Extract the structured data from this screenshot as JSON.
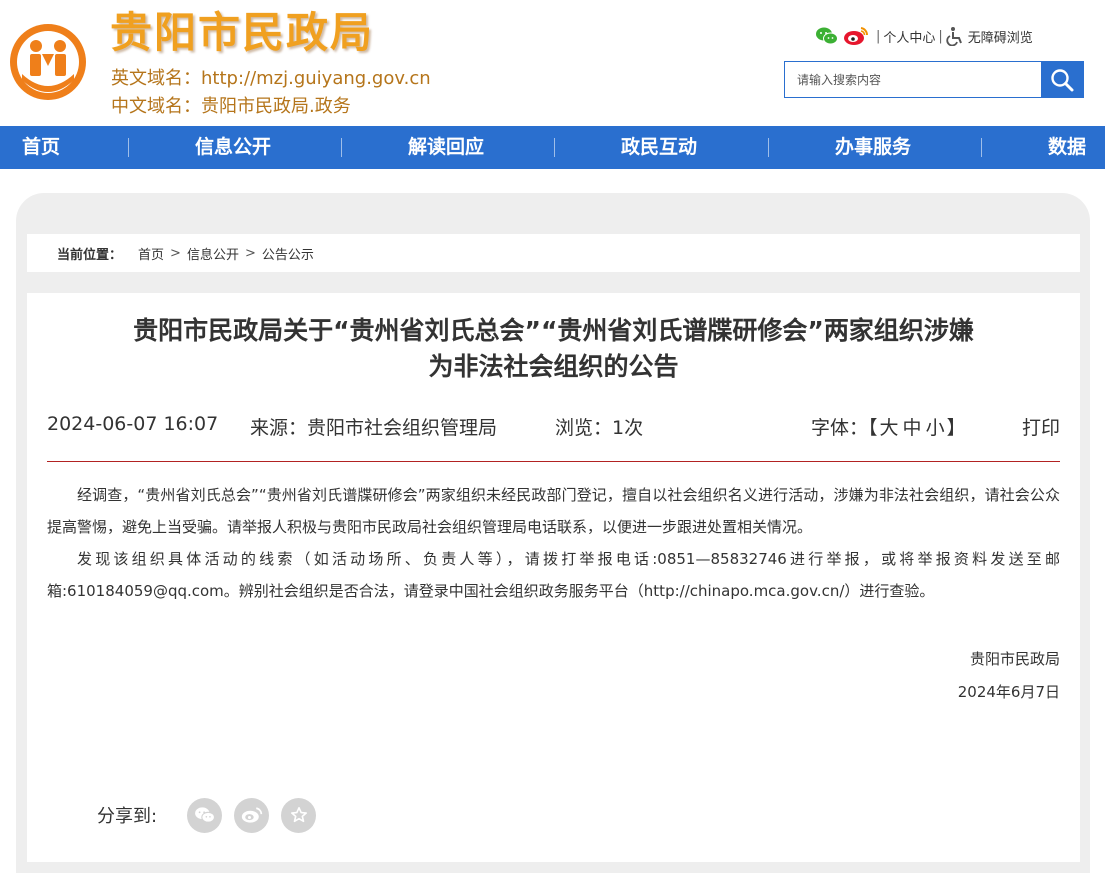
{
  "site": {
    "title": "贵阳市民政局",
    "domain_en": "英文域名：http://mzj.guiyang.gov.cn",
    "domain_cn": "中文域名：贵阳市民政局.政务",
    "logo_icon": "civil-affairs-emblem",
    "brand_color": "#f0a020"
  },
  "top_tools": {
    "wechat_icon": "wechat-icon",
    "weibo_icon": "weibo-icon",
    "personal_center": "个人中心",
    "accessibility_icon": "wheelchair-icon",
    "accessible_browse": "无障碍浏览"
  },
  "search": {
    "placeholder": "请输入搜索内容",
    "button_icon": "search-icon"
  },
  "nav": {
    "color": "#2a6fcf",
    "items": [
      {
        "label": "首页"
      },
      {
        "label": "信息公开"
      },
      {
        "label": "解读回应"
      },
      {
        "label": "政民互动"
      },
      {
        "label": "办事服务"
      },
      {
        "label": "数据"
      }
    ]
  },
  "breadcrumb": {
    "label": "当前位置：",
    "items": [
      {
        "label": "首页"
      },
      {
        "label": "信息公开"
      },
      {
        "label": "公告公示"
      }
    ]
  },
  "article": {
    "title_line1": "贵阳市民政局关于“贵州省刘氏总会”“贵州省刘氏谱牒研修会”两家组织涉嫌",
    "title_line2": "为非法社会组织的公告",
    "date": "2024-06-07 16:07",
    "source_label": "来源：",
    "source": "贵阳市社会组织管理局",
    "views_label": "浏览：",
    "views": "1次",
    "font_label": "字体：",
    "font_open": "【",
    "font_large": "大",
    "font_medium": "中",
    "font_small": "小",
    "font_close": "】",
    "print": "打印",
    "divider_color": "#b22222",
    "paragraphs": [
      "经调查，“贵州省刘氏总会”“贵州省刘氏谱牒研修会”两家组织未经民政部门登记，擅自以社会组织名义进行活动，涉嫌为非法社会组织，请社会公众提高警惕，避免上当受骗。请举报人积极与贵阳市民政局社会组织管理局电话联系，以便进一步跟进处置相关情况。",
      "发现该组织具体活动的线索（如活动场所、负责人等），请拨打举报电话:0851—85832746进行举报，或将举报资料发送至邮箱:610184059@qq.com。辨别社会组织是否合法，请登录中国社会组织政务服务平台（http://chinapo.mca.gov.cn/）进行查验。"
    ],
    "signature": "贵阳市民政局",
    "sign_date": "2024年6月7日"
  },
  "share": {
    "label": "分享到:",
    "buttons": [
      {
        "icon": "wechat-icon"
      },
      {
        "icon": "weibo-icon"
      },
      {
        "icon": "star-icon"
      }
    ]
  }
}
